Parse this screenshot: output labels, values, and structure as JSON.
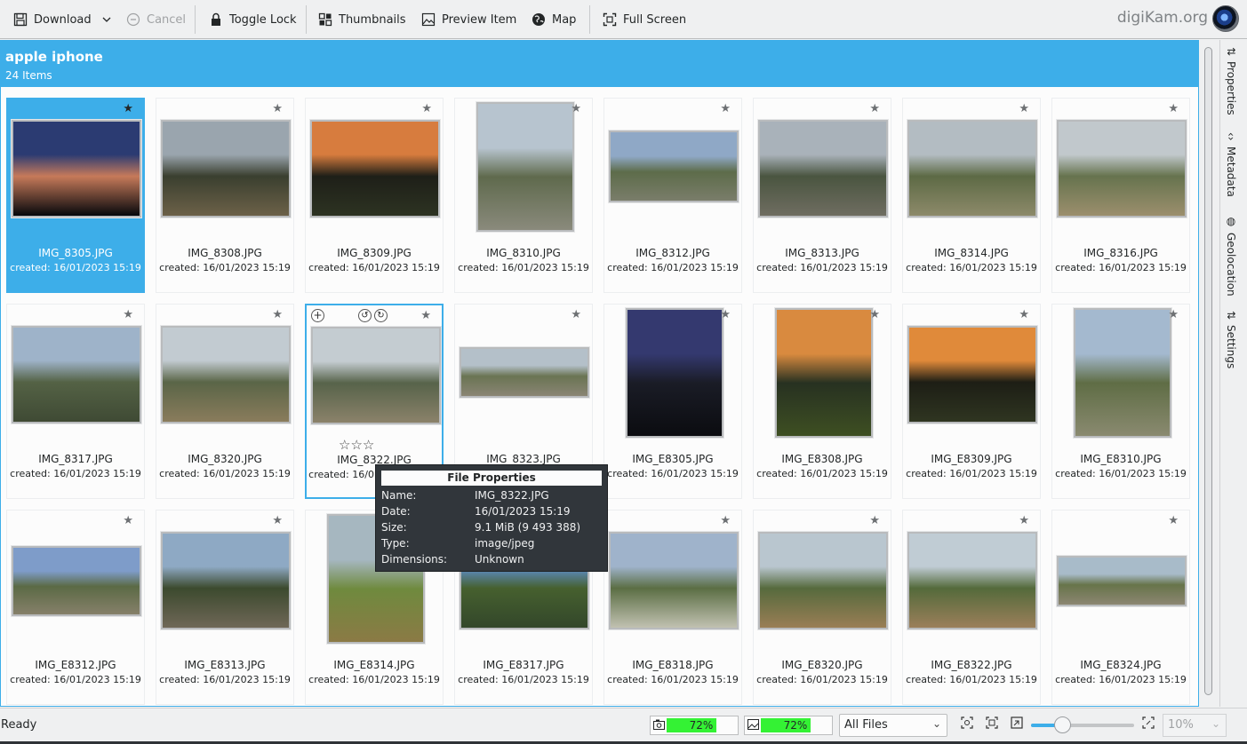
{
  "toolbar": {
    "download_label": "Download",
    "cancel_label": "Cancel",
    "toggle_lock_label": "Toggle Lock",
    "thumbnails_label": "Thumbnails",
    "preview_item_label": "Preview Item",
    "map_label": "Map",
    "full_screen_label": "Full Screen",
    "brand": "digiKam.org"
  },
  "header": {
    "title": "apple iphone",
    "count": "24 Items"
  },
  "sidebar": {
    "tabs": [
      {
        "label": "Properties",
        "icon": "sliders-icon"
      },
      {
        "label": "Metadata",
        "icon": "code-icon"
      },
      {
        "label": "Geolocation",
        "icon": "globe-icon"
      },
      {
        "label": "Settings",
        "icon": "sliders-icon"
      }
    ]
  },
  "items": [
    {
      "name": "IMG_8305.JPG",
      "date": "created: 16/01/2023 15:19",
      "colors": [
        "#2b3b72",
        "#c77a5a",
        "#05070b"
      ]
    },
    {
      "name": "IMG_8308.JPG",
      "date": "created: 16/01/2023 15:19",
      "colors": [
        "#9aa5ae",
        "#3a3f2f",
        "#6c6148"
      ]
    },
    {
      "name": "IMG_8309.JPG",
      "date": "created: 16/01/2023 15:19",
      "colors": [
        "#d77c3e",
        "#1e1f18",
        "#2d3322"
      ]
    },
    {
      "name": "IMG_8310.JPG",
      "date": "created: 16/01/2023 15:19",
      "colors": [
        "#b7c4cf",
        "#5f6a4d",
        "#8a8a7c"
      ]
    },
    {
      "name": "IMG_8312.JPG",
      "date": "created: 16/01/2023 15:19",
      "colors": [
        "#8fa8c6",
        "#5d6c4a",
        "#7a7d6a"
      ]
    },
    {
      "name": "IMG_8313.JPG",
      "date": "created: 16/01/2023 15:19",
      "colors": [
        "#a9b2ba",
        "#4a5540",
        "#6f6d61"
      ]
    },
    {
      "name": "IMG_8314.JPG",
      "date": "created: 16/01/2023 15:19",
      "colors": [
        "#b3bcc2",
        "#5d6a45",
        "#8d8a6a"
      ]
    },
    {
      "name": "IMG_8316.JPG",
      "date": "created: 16/01/2023 15:19",
      "colors": [
        "#c1c8cc",
        "#66734e",
        "#9c8f6d"
      ]
    },
    {
      "name": "IMG_8317.JPG",
      "date": "created: 16/01/2023 15:19",
      "colors": [
        "#9eb3c9",
        "#546245",
        "#3f4a34"
      ]
    },
    {
      "name": "IMG_8320.JPG",
      "date": "created: 16/01/2023 15:19",
      "colors": [
        "#c2cbd1",
        "#5a6547",
        "#8a7c5c"
      ]
    },
    {
      "name": "IMG_8322.JPG",
      "date": "created: 16/01/2023 15:19",
      "colors": [
        "#c4ccd1",
        "#57634a",
        "#8b826a"
      ]
    },
    {
      "name": "IMG_8323.JPG",
      "date": "created: 16/01/2023 15:19",
      "colors": [
        "#b4c0c9",
        "#6a7453",
        "#8a8574"
      ]
    },
    {
      "name": "IMG_E8305.JPG",
      "date": "created: 16/01/2023 15:19",
      "colors": [
        "#34396f",
        "#1a1c26",
        "#0b0c10"
      ]
    },
    {
      "name": "IMG_E8308.JPG",
      "date": "created: 16/01/2023 15:19",
      "colors": [
        "#d98a3f",
        "#273121",
        "#3e4f22"
      ]
    },
    {
      "name": "IMG_E8309.JPG",
      "date": "created: 16/01/2023 15:19",
      "colors": [
        "#e08a3a",
        "#1d1e15",
        "#2f3521"
      ]
    },
    {
      "name": "IMG_E8310.JPG",
      "date": "created: 16/01/2023 15:19",
      "colors": [
        "#a4b9cf",
        "#5f6d45",
        "#8a8a70"
      ]
    },
    {
      "name": "IMG_E8312.JPG",
      "date": "created: 16/01/2023 15:19",
      "colors": [
        "#7e9cc9",
        "#5b6a45",
        "#86806a"
      ]
    },
    {
      "name": "IMG_E8313.JPG",
      "date": "created: 16/01/2023 15:19",
      "colors": [
        "#8ea9c4",
        "#3c4a2e",
        "#6f6757"
      ]
    },
    {
      "name": "IMG_E8314.JPG",
      "date": "created: 16/01/2023 15:19",
      "colors": [
        "#a6b7c0",
        "#6f8a3e",
        "#8b7a45"
      ]
    },
    {
      "name": "IMG_E8317.JPG",
      "date": "created: 16/01/2023 15:19",
      "colors": [
        "#5f8fcf",
        "#46602f",
        "#33472a"
      ]
    },
    {
      "name": "IMG_E8318.JPG",
      "date": "created: 16/01/2023 15:19",
      "colors": [
        "#9fb3cb",
        "#5b6e44",
        "#c1c1b1"
      ]
    },
    {
      "name": "IMG_E8320.JPG",
      "date": "created: 16/01/2023 15:19",
      "colors": [
        "#b9c6cf",
        "#566a3d",
        "#9a7e55"
      ]
    },
    {
      "name": "IMG_E8322.JPG",
      "date": "created: 16/01/2023 15:19",
      "colors": [
        "#c0ccd4",
        "#546a3b",
        "#9b7f5a"
      ]
    },
    {
      "name": "IMG_E8324.JPG",
      "date": "created: 16/01/2023 15:19",
      "colors": [
        "#a8bbc9",
        "#67744a",
        "#8c8672"
      ]
    }
  ],
  "tooltip": {
    "title": "File Properties",
    "rows": [
      {
        "key": "Name:",
        "value": "IMG_8322.JPG"
      },
      {
        "key": "Date:",
        "value": "16/01/2023 15:19"
      },
      {
        "key": "Size:",
        "value": "9.1 MiB (9 493 388)"
      },
      {
        "key": "Type:",
        "value": "image/jpeg"
      },
      {
        "key": "Dimensions:",
        "value": "Unknown"
      }
    ]
  },
  "status": {
    "text": "Ready",
    "camera_gauge": {
      "label": "72%",
      "level": 0.72
    },
    "disk_gauge": {
      "label": "72%",
      "level": 0.72
    },
    "filter_value": "All Files",
    "zoom_value": "10%",
    "zoom_slider_level": 0.3
  },
  "colors": {
    "accent": "#3daee9",
    "gauge_fill": "#34f234"
  }
}
